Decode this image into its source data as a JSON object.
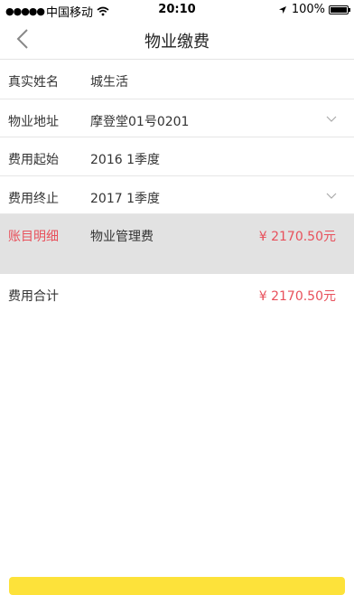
{
  "status_bar": {
    "signal": "●●●●●",
    "carrier": "中国移动",
    "time": "20:10",
    "battery": "100%"
  },
  "nav": {
    "title": "物业缴费"
  },
  "form": {
    "name": {
      "label": "真实姓名",
      "value": "城生活"
    },
    "address": {
      "label": "物业地址",
      "value": "摩登堂01号0201"
    },
    "start": {
      "label": "费用起始",
      "value": "2016  1季度"
    },
    "end": {
      "label": "费用终止",
      "value": "2017  1季度"
    },
    "detail": {
      "label": "账目明细",
      "item": "物业管理费",
      "amount": "¥ 2170.50元"
    },
    "total": {
      "label": "费用合计",
      "amount": "¥ 2170.50元"
    }
  },
  "colors": {
    "accent_red": "#e8505b",
    "button_yellow": "#fde23a",
    "highlight_gray": "#e2e2e2"
  }
}
